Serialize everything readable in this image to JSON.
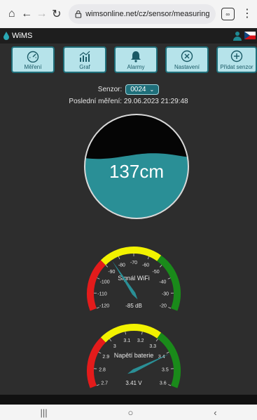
{
  "browser": {
    "url": "wimsonline.net/cz/sensor/measuring",
    "tabs_count": "∞"
  },
  "app": {
    "brand": "WiMS"
  },
  "toolbar": [
    {
      "label": "Měření",
      "icon": "gauge-icon"
    },
    {
      "label": "Graf",
      "icon": "chart-icon"
    },
    {
      "label": "Alarmy",
      "icon": "bell-icon"
    },
    {
      "label": "Nastavení",
      "icon": "settings-icon"
    },
    {
      "label": "Přidat senzor",
      "icon": "add-icon"
    }
  ],
  "sensor": {
    "label": "Senzor:",
    "selected": "0024"
  },
  "last_measurement": {
    "label": "Poslední měření:",
    "value": "29.06.2023 21:29:48"
  },
  "tank": {
    "value_text": "137cm",
    "fill_fraction": 0.6
  },
  "wifi_gauge": {
    "title": "Signál WiFi",
    "value_text": "-85 dB",
    "value": -85,
    "min": -120,
    "max": -20,
    "ticks": [
      "-120",
      "-110",
      "-100",
      "-90",
      "-80",
      "-70",
      "-60",
      "-50",
      "-40",
      "-30",
      "-20"
    ]
  },
  "battery_gauge": {
    "title": "Napětí baterie",
    "value_text": "3.41 V",
    "value": 3.41,
    "min": 2.7,
    "max": 3.6,
    "ticks": [
      "2.7",
      "2.8",
      "2.9",
      "3",
      "3.1",
      "3.2",
      "3.3",
      "3.4",
      "3.5",
      "3.6"
    ]
  },
  "colors": {
    "accent": "#1f6f7a",
    "water": "#2a8f96",
    "gauge_red": "#e31b1b",
    "gauge_yellow": "#f2f200",
    "gauge_green": "#1a8a1a"
  }
}
